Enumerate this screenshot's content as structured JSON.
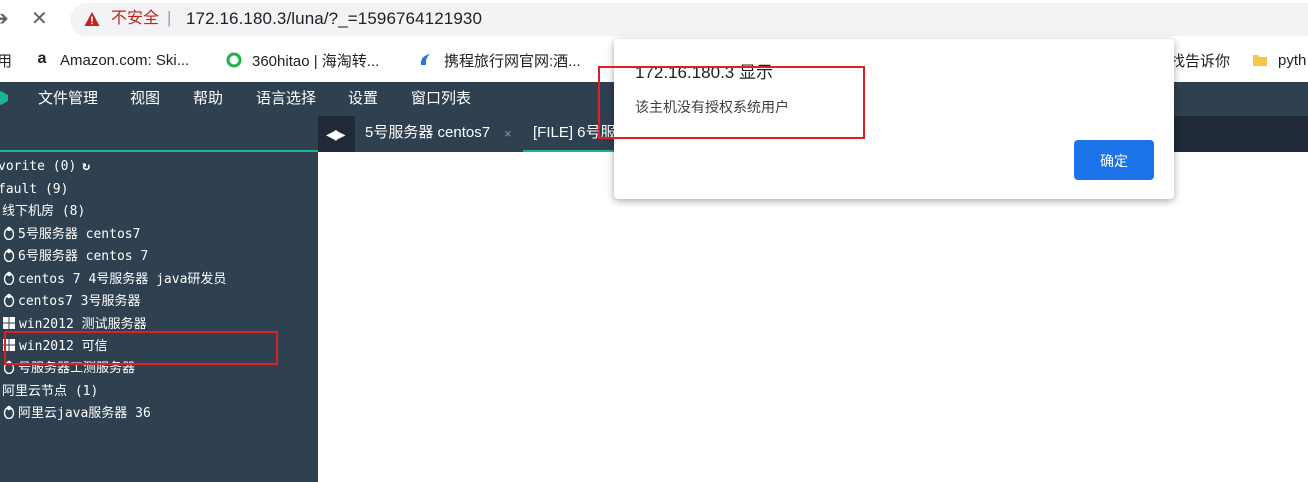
{
  "browser": {
    "back_icon": "arrow-right-icon",
    "reload_icon": "close-icon",
    "insecure_label": "不安全",
    "separator": "|",
    "url": "172.16.180.3/luna/?_=1596764121930"
  },
  "bookmarks": [
    {
      "label": "用",
      "icon": "none"
    },
    {
      "label": "Amazon.com: Ski...",
      "icon": "amazon-icon",
      "color": "#000000"
    },
    {
      "label": "360hitao | 海淘转...",
      "icon": "recycle-icon",
      "color": "#20b14a"
    },
    {
      "label": "携程旅行网官网:酒...",
      "icon": "ctrip-icon",
      "color": "#2577e3"
    },
    {
      "label": "找告诉你",
      "icon": "none"
    },
    {
      "label": "pyth",
      "icon": "folder-icon",
      "color": "#f6c744"
    }
  ],
  "menu": {
    "items": [
      "文件管理",
      "视图",
      "帮助",
      "语言选择",
      "设置",
      "窗口列表"
    ]
  },
  "tabs": {
    "items": [
      {
        "label": "5号服务器 centos7",
        "close": "×"
      },
      {
        "label": "[FILE] 6号服务器"
      }
    ]
  },
  "tree": {
    "rows": [
      {
        "label": "vorite (0)",
        "icon": "none",
        "extra": "refresh-icon"
      },
      {
        "label": "fault (9)",
        "icon": "none"
      },
      {
        "label": "线下机房 (8)",
        "icon": "none"
      },
      {
        "label": "5号服务器 centos7",
        "icon": "linux-icon"
      },
      {
        "label": "6号服务器 centos 7",
        "icon": "linux-icon"
      },
      {
        "label": "centos 7 4号服务器 java研发员",
        "icon": "linux-icon"
      },
      {
        "label": "centos7 3号服务器",
        "icon": "linux-icon"
      },
      {
        "label": "win2012 测试服务器",
        "icon": "windows-icon"
      },
      {
        "label": "win2012 可信",
        "icon": "windows-icon"
      },
      {
        "label": "号服务器工测服务器",
        "icon": "linux-icon"
      },
      {
        "label": "阿里云节点 (1)",
        "icon": "none"
      },
      {
        "label": "阿里云java服务器 36",
        "icon": "linux-icon"
      }
    ]
  },
  "dialog": {
    "title": "172.16.180.3 显示",
    "message": "该主机没有授权系统用户",
    "ok_label": "确定"
  },
  "colors": {
    "menubar": "#2f4050",
    "accent": "#1ab394",
    "dialog_button": "#1a73e8",
    "highlight": "#e02020"
  }
}
